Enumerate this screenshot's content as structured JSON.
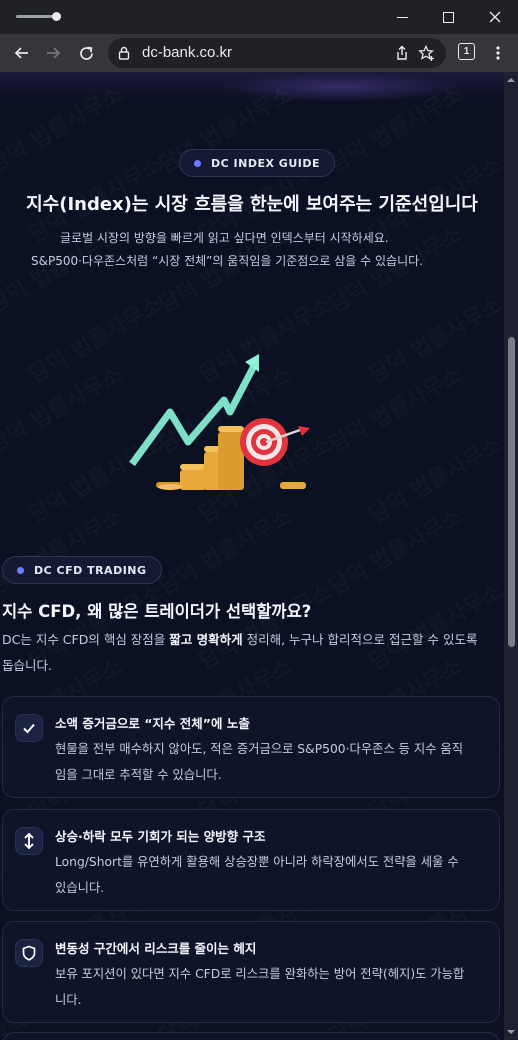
{
  "browser": {
    "url": "dc-bank.co.kr",
    "tab_count": "1"
  },
  "hero": {
    "badge": "DC INDEX GUIDE",
    "title": "지수(Index)는 시장 흐름을 한눈에 보여주는 기준선입니다",
    "subtitle_line1": "글로벌 시장의 방향을 빠르게 읽고 싶다면 인덱스부터 시작하세요.",
    "subtitle_line2": "S&P500·다우존스처럼 “시장 전체”의 움직임을 기준점으로 삼을 수 있습니다."
  },
  "cfd": {
    "badge": "DC CFD TRADING",
    "title": "지수 CFD, 왜 많은 트레이더가 선택할까요?",
    "desc_pre": "DC는 지수 CFD의 핵심 장점을 ",
    "desc_bold": "짧고 명확하게",
    "desc_post": " 정리해, 누구나 합리적으로 접근할 수 있도록",
    "desc_line2": "돕습니다.",
    "cards": [
      {
        "icon": "check-icon",
        "title": "소액 증거금으로 “지수 전체”에 노출",
        "line1": "현물을 전부 매수하지 않아도, 적은 증거금으로 S&P500·다우존스 등 지수 움직",
        "line2": "임을 그대로 추적할 수 있습니다."
      },
      {
        "icon": "up-down-arrows-icon",
        "title": "상승·하락 모두 기회가 되는 양방향 구조",
        "line1": "Long/Short를 유연하게 활용해 상승장뿐 아니라 하락장에서도 전략을 세울 수",
        "line2": "있습니다."
      },
      {
        "icon": "shield-icon",
        "title": "변동성 구간에서 리스크를 줄이는 헤지",
        "line1": "보유 포지션이 있다면 지수 CFD로 리스크를 완화하는 방어 전략(헤지)도 가능합",
        "line2": "니다."
      }
    ]
  },
  "watermark_text": "담덕 법률사무소",
  "colors": {
    "accent": "#6a7dff",
    "background": "#0b1022",
    "arrow_teal": "#7fe0c8",
    "coin_gold": "#e8a93a",
    "target_red": "#e0343f"
  }
}
